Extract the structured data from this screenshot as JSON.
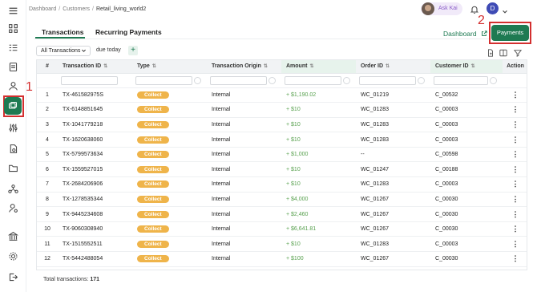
{
  "breadcrumb": [
    "Dashboard",
    "Customers",
    "Retail_living_world2"
  ],
  "header": {
    "ask_label": "Ask Kai",
    "user_initial": "D"
  },
  "tabs": [
    "Transactions",
    "Recurring Payments"
  ],
  "dashboard_link": "Dashboard",
  "payments_button": "Payments",
  "annotations": [
    "1",
    "2"
  ],
  "filters": {
    "scope": "All Transactions",
    "date": "due today"
  },
  "table": {
    "columns": [
      "#",
      "Transaction ID",
      "Type",
      "Transaction Origin",
      "Amount",
      "Order ID",
      "Customer ID",
      "Action"
    ],
    "rows": [
      [
        "1",
        "TX-461582975S",
        "Collect",
        "Internal",
        "+ $1,190.02",
        "WC_01219",
        "C_00532"
      ],
      [
        "2",
        "TX-6148851645",
        "Collect",
        "Internal",
        "+ $10",
        "WC_01283",
        "C_00003"
      ],
      [
        "3",
        "TX-1041779218",
        "Collect",
        "Internal",
        "+ $10",
        "WC_01283",
        "C_00003"
      ],
      [
        "4",
        "TX-1620638060",
        "Collect",
        "Internal",
        "+ $10",
        "WC_01283",
        "C_00003"
      ],
      [
        "5",
        "TX-5799573634",
        "Collect",
        "Internal",
        "+ $1,000",
        "--",
        "C_00598"
      ],
      [
        "6",
        "TX-1559527015",
        "Collect",
        "Internal",
        "+ $10",
        "WC_01247",
        "C_00188"
      ],
      [
        "7",
        "TX-2684206906",
        "Collect",
        "Internal",
        "+ $10",
        "WC_01283",
        "C_00003"
      ],
      [
        "8",
        "TX-1278535344",
        "Collect",
        "Internal",
        "+ $4,000",
        "WC_01267",
        "C_00030"
      ],
      [
        "9",
        "TX-9445234608",
        "Collect",
        "Internal",
        "+ $2,460",
        "WC_01267",
        "C_00030"
      ],
      [
        "10",
        "TX-9060308940",
        "Collect",
        "Internal",
        "+ $6,641.81",
        "WC_01267",
        "C_00030"
      ],
      [
        "11",
        "TX-1515552511",
        "Collect",
        "Internal",
        "+ $10",
        "WC_01283",
        "C_00003"
      ],
      [
        "12",
        "TX-5442488054",
        "Collect",
        "Internal",
        "+ $100",
        "WC_01267",
        "C_00030"
      ]
    ]
  },
  "footer": {
    "label": "Total transactions:",
    "count": "171"
  },
  "colors": {
    "accent": "#1e7a52",
    "badge": "#efb44a",
    "amount": "#58a14f",
    "annotation": "#d32f2f"
  }
}
